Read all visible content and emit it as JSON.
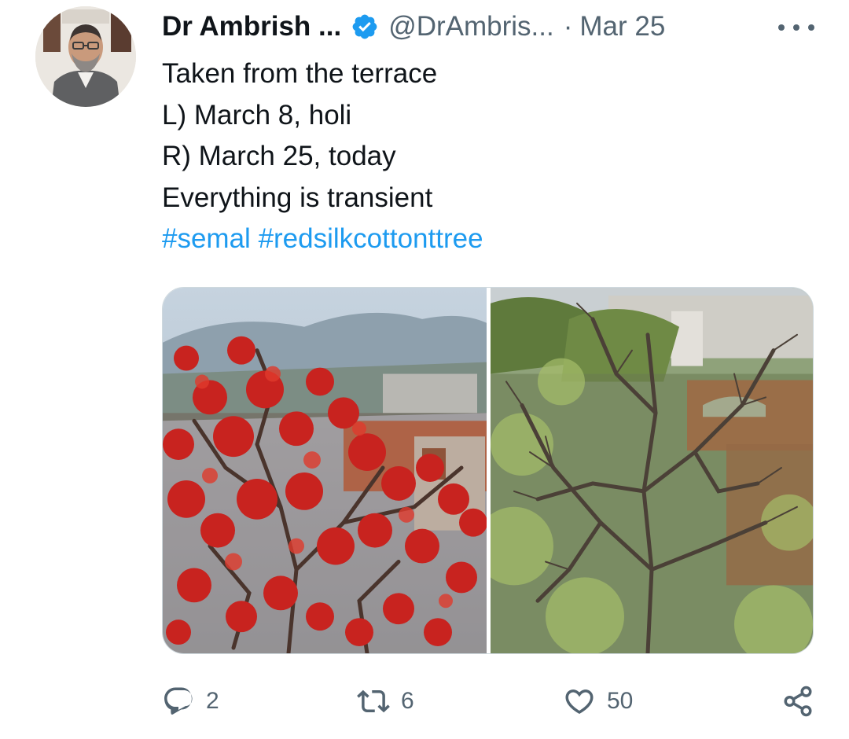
{
  "tweet": {
    "author": {
      "display_name": "Dr Ambrish ...",
      "handle": "@DrAmbris...",
      "verified": true
    },
    "separator": "·",
    "date": "Mar 25",
    "text_lines": [
      "Taken from the terrace",
      "L) March 8, holi",
      "R) March 25, today",
      "Everything is transient"
    ],
    "hashtags": [
      "#semal",
      "#redsilkcottonttree"
    ],
    "media": [
      {
        "content": "red-silk-cotton-tree-in-bloom-photo"
      },
      {
        "content": "bare-silk-cotton-tree-photo"
      }
    ]
  },
  "actions": {
    "reply": {
      "icon": "reply-icon",
      "count": "2"
    },
    "retweet": {
      "icon": "retweet-icon",
      "count": "6"
    },
    "like": {
      "icon": "heart-icon",
      "count": "50"
    },
    "share": {
      "icon": "share-icon"
    }
  },
  "colors": {
    "text": "#0f1419",
    "secondary": "#536471",
    "link": "#1d9bf0",
    "verified_badge": "#1d9bf0",
    "divider": "#cfd9de"
  }
}
